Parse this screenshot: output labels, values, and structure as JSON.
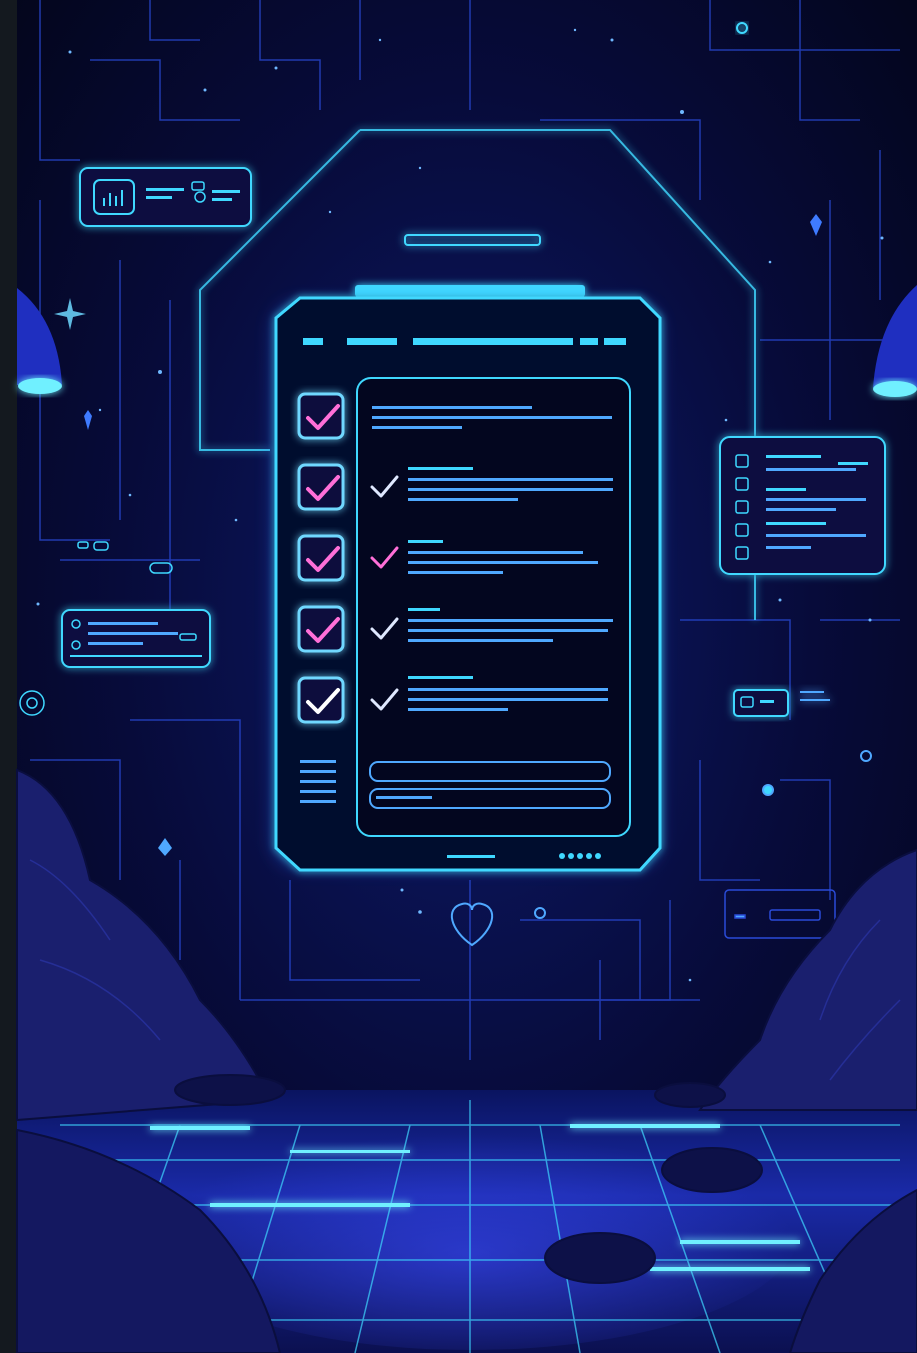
{
  "palette": {
    "background_dark": "#05071f",
    "background_mid": "#0b1250",
    "neon_cyan": "#3fd8ff",
    "neon_blue": "#2f6bff",
    "neon_pink": "#ff6fd8",
    "rock": "#1a1f6e",
    "strip": "#14191f"
  },
  "scene": {
    "subject": "device-checklist",
    "checklist": {
      "items": [
        {
          "checked": true
        },
        {
          "checked": true
        },
        {
          "checked": true
        },
        {
          "checked": true
        },
        {
          "checked": true
        }
      ]
    }
  }
}
